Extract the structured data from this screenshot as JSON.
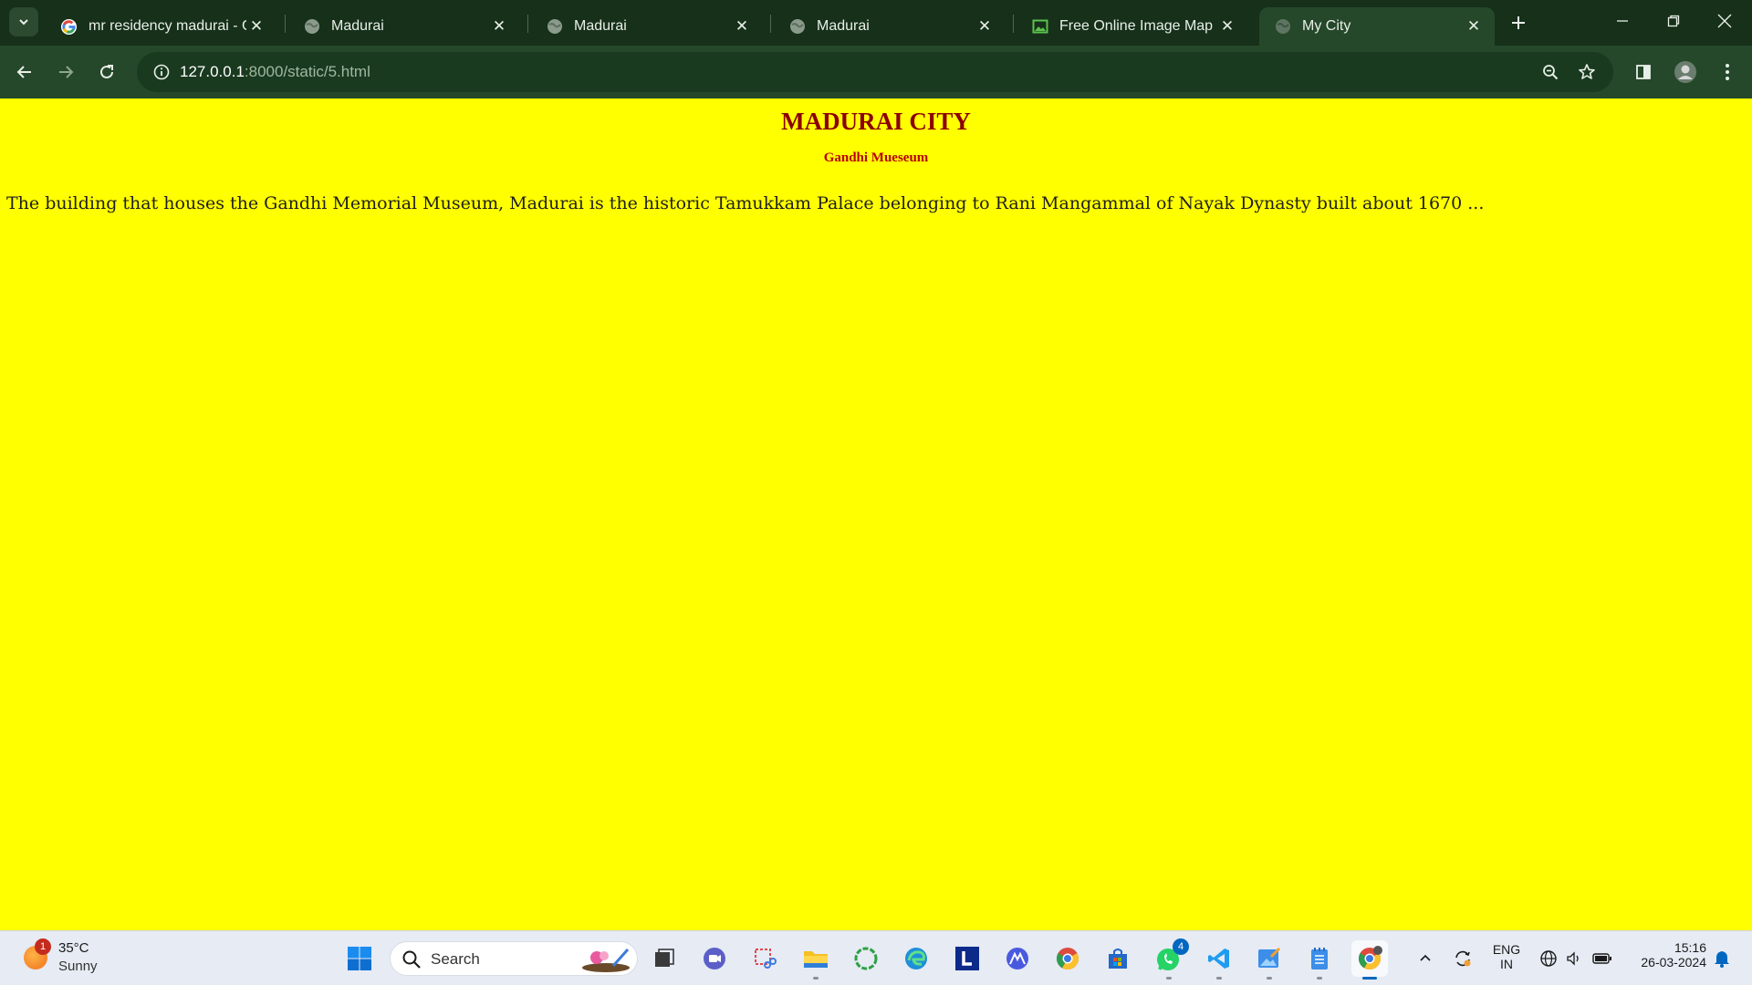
{
  "browser": {
    "tabs": [
      {
        "title": "mr residency madurai - Go",
        "favicon": "google-icon",
        "active": false
      },
      {
        "title": "Madurai",
        "favicon": "globe-icon",
        "active": false
      },
      {
        "title": "Madurai",
        "favicon": "globe-icon",
        "active": false
      },
      {
        "title": "Madurai",
        "favicon": "globe-icon",
        "active": false
      },
      {
        "title": "Free Online Image Map Ge",
        "favicon": "image-icon",
        "active": false
      },
      {
        "title": "My City",
        "favicon": "globe-icon",
        "active": true
      }
    ],
    "url_host": "127.0.0.1",
    "url_rest": ":8000/static/5.html"
  },
  "page": {
    "heading": "MADURAI CITY",
    "subheading": "Gandhi Mueseum",
    "paragraph": "The building that houses the Gandhi Memorial Museum, Madurai is the historic Tamukkam Palace belonging to Rani Mangammal of Nayak Dynasty built about 1670 ...",
    "background_color": "#ffff00",
    "heading_color": "#8b0000"
  },
  "taskbar": {
    "weather_temp": "35°C",
    "weather_condition": "Sunny",
    "weather_badge": "1",
    "search_label": "Search",
    "whatsapp_badge": "4",
    "language_line1": "ENG",
    "language_line2": "IN",
    "time": "15:16",
    "date": "26-03-2024"
  },
  "colors": {
    "tabstrip": "#16301a",
    "toolbar": "#25482a",
    "taskbar": "#e6ebf4"
  }
}
